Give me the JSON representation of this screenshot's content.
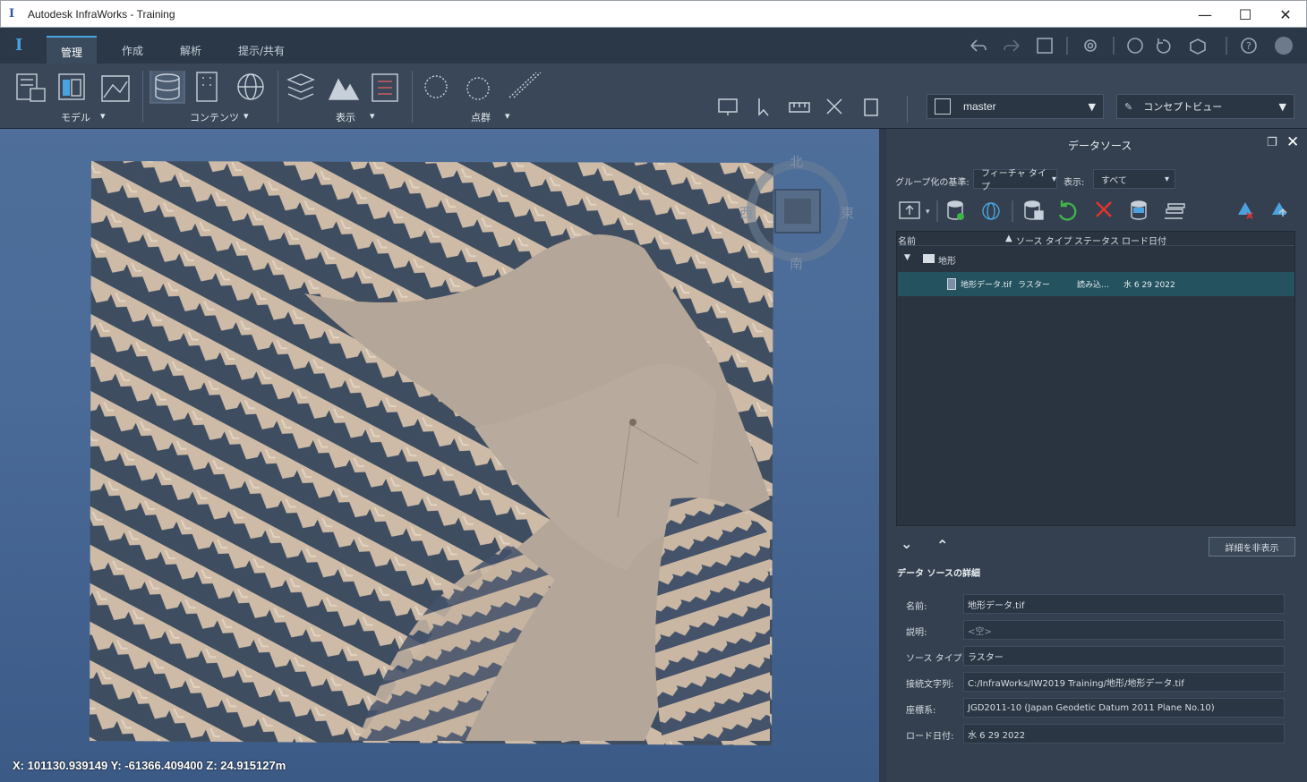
{
  "window": {
    "title": "Autodesk InfraWorks - Training",
    "minimize": "—",
    "maximize": "☐",
    "close": "✕"
  },
  "tabs": [
    "管理",
    "作成",
    "解析",
    "提示/共有"
  ],
  "ribbon": {
    "groups": [
      "モデル",
      "コンテンツ",
      "表示",
      "点群"
    ],
    "proposal": "master",
    "view": "コンセプトビュー"
  },
  "compass": {
    "north": "北",
    "south": "南",
    "east": "東",
    "west": "西"
  },
  "status": {
    "coords": "X: 101130.939149 Y: -61366.409400 Z: 24.915127m"
  },
  "panel": {
    "title": "データソース",
    "group_by_label": "グループ化の基準:",
    "group_by_value": "フィーチャ タイプ",
    "show_label": "表示:",
    "show_value": "すべて",
    "columns": [
      "名前",
      "ソース タイプ",
      "ステータス",
      "ロード日付"
    ],
    "tree": {
      "folder": "地形",
      "item": {
        "name": "地形データ.tif",
        "type": "ラスター",
        "status": "読み込…",
        "date": "水 6 29 2022"
      }
    },
    "hide_details_button": "詳細を非表示",
    "details_title": "データ ソースの詳細",
    "details": [
      {
        "label": "名前:",
        "value": "地形データ.tif"
      },
      {
        "label": "説明:",
        "value": "<空>"
      },
      {
        "label": "ソース タイプ:",
        "value": "ラスター"
      },
      {
        "label": "接続文字列:",
        "value": "C:/InfraWorks/IW2019 Training/地形/地形データ.tif"
      },
      {
        "label": "座標系:",
        "value": "JGD2011-10 (Japan Geodetic Datum 2011 Plane No.10)"
      },
      {
        "label": "ロード日付:",
        "value": "水 6 29 2022"
      }
    ]
  }
}
